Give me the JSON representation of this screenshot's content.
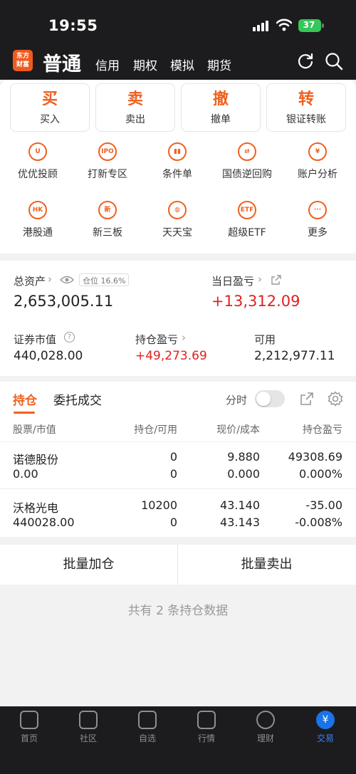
{
  "status": {
    "time": "19:55",
    "battery": "37"
  },
  "header": {
    "logo_line1": "东方",
    "logo_line2": "财富",
    "current": "普通",
    "tabs": [
      "信用",
      "期权",
      "模拟",
      "期货"
    ]
  },
  "actions": [
    {
      "big": "买",
      "small": "买入"
    },
    {
      "big": "卖",
      "small": "卖出"
    },
    {
      "big": "撤",
      "small": "撤单"
    },
    {
      "big": "转",
      "small": "银证转账"
    }
  ],
  "grid": [
    {
      "label": "优优投顾",
      "glyph": "U",
      "icon": "uu-advisor-icon"
    },
    {
      "label": "打新专区",
      "glyph": "IPO",
      "icon": "ipo-icon"
    },
    {
      "label": "条件单",
      "glyph": "▮▮",
      "icon": "condition-order-icon"
    },
    {
      "label": "国债逆回购",
      "glyph": "⇄",
      "icon": "bond-repo-icon"
    },
    {
      "label": "账户分析",
      "glyph": "¥",
      "icon": "account-analysis-icon"
    },
    {
      "label": "港股通",
      "glyph": "HK",
      "icon": "hk-connect-icon"
    },
    {
      "label": "新三板",
      "glyph": "新",
      "icon": "neeq-icon"
    },
    {
      "label": "天天宝",
      "glyph": "◍",
      "icon": "piggy-bank-icon"
    },
    {
      "label": "超级ETF",
      "glyph": "ETF",
      "icon": "etf-icon"
    },
    {
      "label": "更多",
      "glyph": "···",
      "icon": "more-icon"
    }
  ],
  "assets": {
    "total_label": "总资产",
    "total_value": "2,653,005.11",
    "position_ratio": "仓位 16.6%",
    "daily_pl_label": "当日盈亏",
    "daily_pl_value": "+13,312.09",
    "market_value_label": "证券市值",
    "market_value": "440,028.00",
    "holding_pl_label": "持仓盈亏",
    "holding_pl_value": "+49,273.69",
    "available_label": "可用",
    "available_value": "2,212,977.11"
  },
  "position_tabs": {
    "active": "持仓",
    "other": "委托成交",
    "timeshare": "分时"
  },
  "table": {
    "headers": [
      "股票/市值",
      "持仓/可用",
      "现价/成本",
      "持仓盈亏"
    ],
    "rows": [
      {
        "name": "诺德股份",
        "mv": "0.00",
        "hold": "0",
        "avail": "0",
        "price": "9.880",
        "cost": "0.000",
        "pl": "49308.69",
        "pl_pct": "0.000%",
        "dir": "up"
      },
      {
        "name": "沃格光电",
        "mv": "440028.00",
        "hold": "10200",
        "avail": "0",
        "price": "43.140",
        "cost": "43.143",
        "pl": "-35.00",
        "pl_pct": "-0.008%",
        "dir": "down"
      }
    ]
  },
  "batch": {
    "add": "批量加仓",
    "sell": "批量卖出"
  },
  "summary": "共有 2 条持仓数据",
  "tabbar": [
    "首页",
    "社区",
    "自选",
    "行情",
    "理财",
    "交易"
  ],
  "colors": {
    "accent": "#f0601e",
    "up": "#e02020",
    "down": "#22a03a",
    "active_tab": "#1a73e8"
  }
}
